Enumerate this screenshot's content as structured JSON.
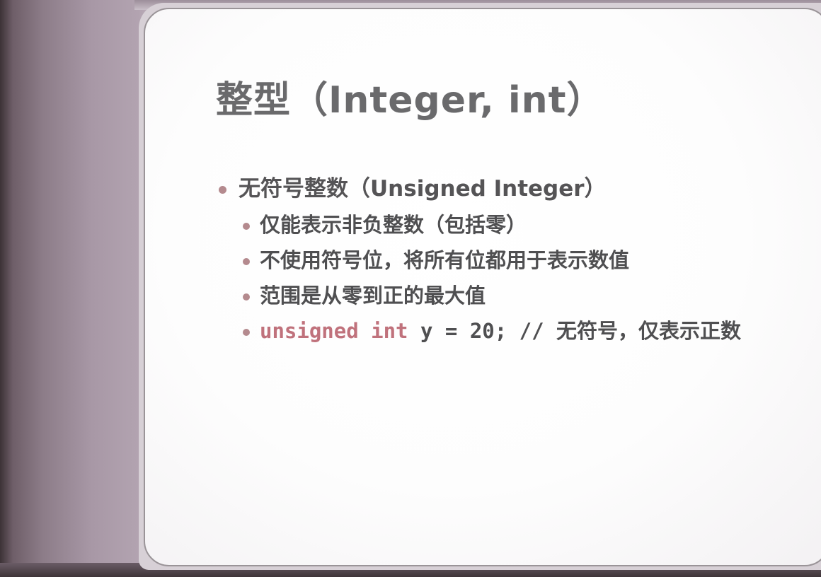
{
  "slide": {
    "title": "整型（Integer, int）",
    "heading": "无符号整数（Unsigned Integer）",
    "points": [
      "仅能表示非负整数（包括零）",
      "不使用符号位，将所有位都用于表示数值",
      "范围是从零到正的最大值"
    ],
    "code": {
      "keyword": "unsigned int",
      "rest": " y = 20; // 无符号，仅表示正数"
    }
  },
  "colors": {
    "bullet": "#b48a8e",
    "keyword": "#c0727c",
    "text": "#555456",
    "title": "#6a6a6c"
  }
}
